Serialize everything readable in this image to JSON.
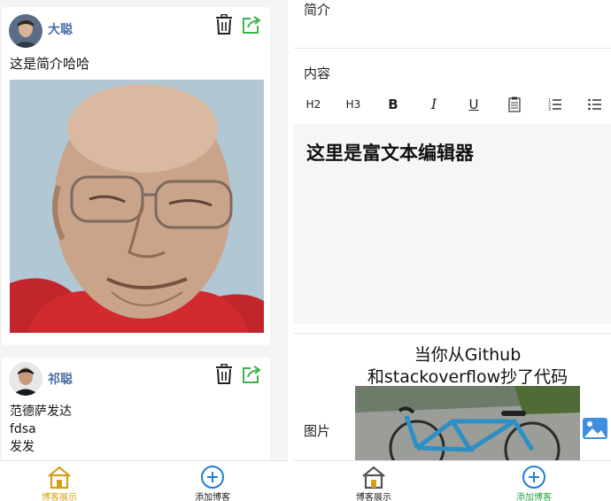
{
  "left_screen": {
    "posts": [
      {
        "author": "大聪",
        "intro": "这是简介哈哈"
      },
      {
        "author": "祁聪",
        "body_lines": [
          "范德萨发达",
          "fdsa",
          "发发"
        ]
      }
    ],
    "tabbar": {
      "items": [
        {
          "label": "博客展示"
        },
        {
          "label": "添加博客"
        }
      ]
    }
  },
  "right_screen": {
    "fields": {
      "summary_label": "简介",
      "content_label": "内容",
      "image_label": "图片"
    },
    "toolbar": {
      "h2": "H2",
      "h3": "H3",
      "bold": "B",
      "italic": "I",
      "underline": "U"
    },
    "editor": {
      "text": "这里是富文本编辑器"
    },
    "meme": {
      "line1": "当你从Github",
      "line2": "和stackoverflow抄了代码"
    },
    "tabbar": {
      "items": [
        {
          "label": "博客展示"
        },
        {
          "label": "添加博客"
        }
      ]
    }
  },
  "colors": {
    "author": "#4a6fa5",
    "share_icon": "#3cb44b",
    "active_home": "#d4a017",
    "active_add": "#2aa14b",
    "add_icon": "#1e7fd6"
  }
}
